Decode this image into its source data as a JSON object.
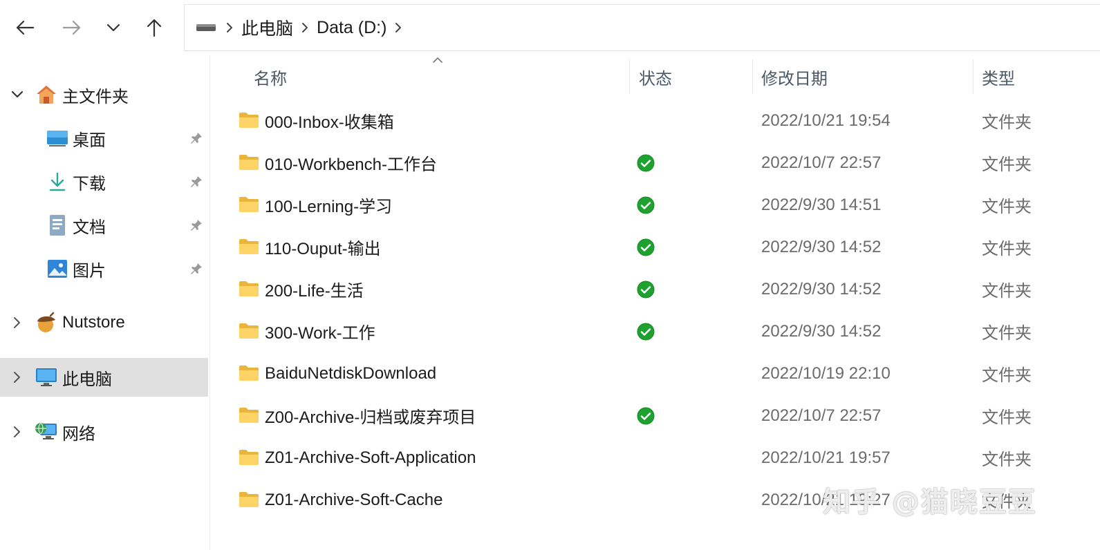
{
  "addressbar": {
    "crumbs": [
      "此电脑",
      "Data (D:)"
    ]
  },
  "sidebar": {
    "home": {
      "label": "主文件夹",
      "icon": "home-icon"
    },
    "quick_access": [
      {
        "label": "桌面",
        "icon": "desktop-icon",
        "pinned": true
      },
      {
        "label": "下载",
        "icon": "download-icon",
        "pinned": true
      },
      {
        "label": "文档",
        "icon": "document-icon",
        "pinned": true
      },
      {
        "label": "图片",
        "icon": "pictures-icon",
        "pinned": true
      }
    ],
    "nutstore": {
      "label": "Nutstore",
      "icon": "acorn-icon"
    },
    "this_pc": {
      "label": "此电脑",
      "icon": "monitor-icon",
      "selected": true
    },
    "network": {
      "label": "网络",
      "icon": "network-icon"
    }
  },
  "columns": {
    "name": "名称",
    "status": "状态",
    "modified": "修改日期",
    "type": "类型"
  },
  "files": [
    {
      "name": "000-Inbox-收集箱",
      "status": "",
      "modified": "2022/10/21 19:54",
      "type": "文件夹"
    },
    {
      "name": "010-Workbench-工作台",
      "status": "synced",
      "modified": "2022/10/7 22:57",
      "type": "文件夹"
    },
    {
      "name": "100-Lerning-学习",
      "status": "synced",
      "modified": "2022/9/30 14:51",
      "type": "文件夹"
    },
    {
      "name": "110-Ouput-输出",
      "status": "synced",
      "modified": "2022/9/30 14:52",
      "type": "文件夹"
    },
    {
      "name": "200-Life-生活",
      "status": "synced",
      "modified": "2022/9/30 14:52",
      "type": "文件夹"
    },
    {
      "name": "300-Work-工作",
      "status": "synced",
      "modified": "2022/9/30 14:52",
      "type": "文件夹"
    },
    {
      "name": "BaiduNetdiskDownload",
      "status": "",
      "modified": "2022/10/19 22:10",
      "type": "文件夹"
    },
    {
      "name": "Z00-Archive-归档或废弃项目",
      "status": "synced",
      "modified": "2022/10/7 22:57",
      "type": "文件夹"
    },
    {
      "name": "Z01-Archive-Soft-Application",
      "status": "",
      "modified": "2022/10/21 19:57",
      "type": "文件夹"
    },
    {
      "name": "Z01-Archive-Soft-Cache",
      "status": "",
      "modified": "2022/10/21 19:27",
      "type": "文件夹"
    }
  ],
  "watermark": "知乎 @猫晓豆豆",
  "colors": {
    "folder": "#f7c84a",
    "synced": "#1fa12f",
    "selected_bg": "#e0e0e0"
  }
}
